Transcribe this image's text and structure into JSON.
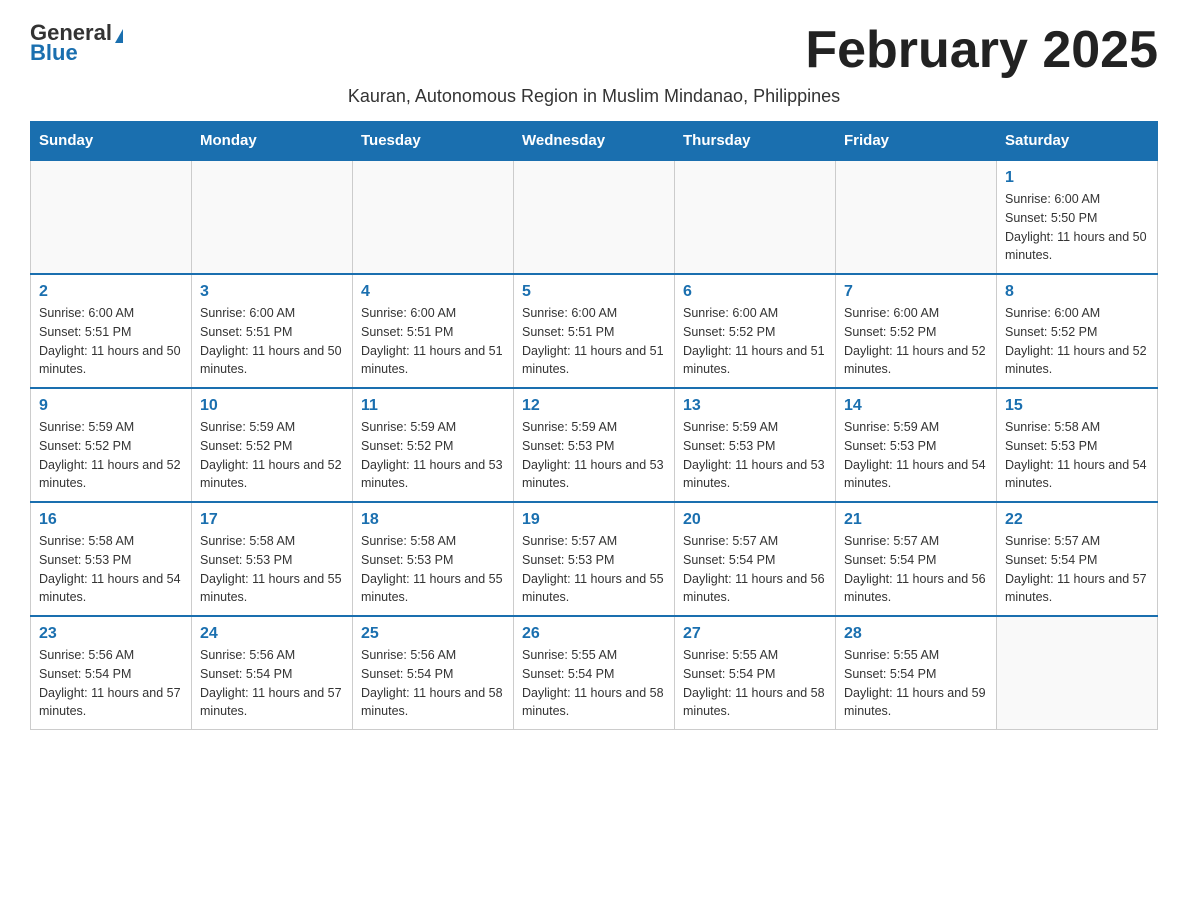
{
  "header": {
    "logo_general": "General",
    "logo_blue": "Blue",
    "month_title": "February 2025",
    "subtitle": "Kauran, Autonomous Region in Muslim Mindanao, Philippines"
  },
  "weekdays": [
    "Sunday",
    "Monday",
    "Tuesday",
    "Wednesday",
    "Thursday",
    "Friday",
    "Saturday"
  ],
  "weeks": [
    [
      {
        "day": "",
        "info": ""
      },
      {
        "day": "",
        "info": ""
      },
      {
        "day": "",
        "info": ""
      },
      {
        "day": "",
        "info": ""
      },
      {
        "day": "",
        "info": ""
      },
      {
        "day": "",
        "info": ""
      },
      {
        "day": "1",
        "info": "Sunrise: 6:00 AM\nSunset: 5:50 PM\nDaylight: 11 hours and 50 minutes."
      }
    ],
    [
      {
        "day": "2",
        "info": "Sunrise: 6:00 AM\nSunset: 5:51 PM\nDaylight: 11 hours and 50 minutes."
      },
      {
        "day": "3",
        "info": "Sunrise: 6:00 AM\nSunset: 5:51 PM\nDaylight: 11 hours and 50 minutes."
      },
      {
        "day": "4",
        "info": "Sunrise: 6:00 AM\nSunset: 5:51 PM\nDaylight: 11 hours and 51 minutes."
      },
      {
        "day": "5",
        "info": "Sunrise: 6:00 AM\nSunset: 5:51 PM\nDaylight: 11 hours and 51 minutes."
      },
      {
        "day": "6",
        "info": "Sunrise: 6:00 AM\nSunset: 5:52 PM\nDaylight: 11 hours and 51 minutes."
      },
      {
        "day": "7",
        "info": "Sunrise: 6:00 AM\nSunset: 5:52 PM\nDaylight: 11 hours and 52 minutes."
      },
      {
        "day": "8",
        "info": "Sunrise: 6:00 AM\nSunset: 5:52 PM\nDaylight: 11 hours and 52 minutes."
      }
    ],
    [
      {
        "day": "9",
        "info": "Sunrise: 5:59 AM\nSunset: 5:52 PM\nDaylight: 11 hours and 52 minutes."
      },
      {
        "day": "10",
        "info": "Sunrise: 5:59 AM\nSunset: 5:52 PM\nDaylight: 11 hours and 52 minutes."
      },
      {
        "day": "11",
        "info": "Sunrise: 5:59 AM\nSunset: 5:52 PM\nDaylight: 11 hours and 53 minutes."
      },
      {
        "day": "12",
        "info": "Sunrise: 5:59 AM\nSunset: 5:53 PM\nDaylight: 11 hours and 53 minutes."
      },
      {
        "day": "13",
        "info": "Sunrise: 5:59 AM\nSunset: 5:53 PM\nDaylight: 11 hours and 53 minutes."
      },
      {
        "day": "14",
        "info": "Sunrise: 5:59 AM\nSunset: 5:53 PM\nDaylight: 11 hours and 54 minutes."
      },
      {
        "day": "15",
        "info": "Sunrise: 5:58 AM\nSunset: 5:53 PM\nDaylight: 11 hours and 54 minutes."
      }
    ],
    [
      {
        "day": "16",
        "info": "Sunrise: 5:58 AM\nSunset: 5:53 PM\nDaylight: 11 hours and 54 minutes."
      },
      {
        "day": "17",
        "info": "Sunrise: 5:58 AM\nSunset: 5:53 PM\nDaylight: 11 hours and 55 minutes."
      },
      {
        "day": "18",
        "info": "Sunrise: 5:58 AM\nSunset: 5:53 PM\nDaylight: 11 hours and 55 minutes."
      },
      {
        "day": "19",
        "info": "Sunrise: 5:57 AM\nSunset: 5:53 PM\nDaylight: 11 hours and 55 minutes."
      },
      {
        "day": "20",
        "info": "Sunrise: 5:57 AM\nSunset: 5:54 PM\nDaylight: 11 hours and 56 minutes."
      },
      {
        "day": "21",
        "info": "Sunrise: 5:57 AM\nSunset: 5:54 PM\nDaylight: 11 hours and 56 minutes."
      },
      {
        "day": "22",
        "info": "Sunrise: 5:57 AM\nSunset: 5:54 PM\nDaylight: 11 hours and 57 minutes."
      }
    ],
    [
      {
        "day": "23",
        "info": "Sunrise: 5:56 AM\nSunset: 5:54 PM\nDaylight: 11 hours and 57 minutes."
      },
      {
        "day": "24",
        "info": "Sunrise: 5:56 AM\nSunset: 5:54 PM\nDaylight: 11 hours and 57 minutes."
      },
      {
        "day": "25",
        "info": "Sunrise: 5:56 AM\nSunset: 5:54 PM\nDaylight: 11 hours and 58 minutes."
      },
      {
        "day": "26",
        "info": "Sunrise: 5:55 AM\nSunset: 5:54 PM\nDaylight: 11 hours and 58 minutes."
      },
      {
        "day": "27",
        "info": "Sunrise: 5:55 AM\nSunset: 5:54 PM\nDaylight: 11 hours and 58 minutes."
      },
      {
        "day": "28",
        "info": "Sunrise: 5:55 AM\nSunset: 5:54 PM\nDaylight: 11 hours and 59 minutes."
      },
      {
        "day": "",
        "info": ""
      }
    ]
  ]
}
